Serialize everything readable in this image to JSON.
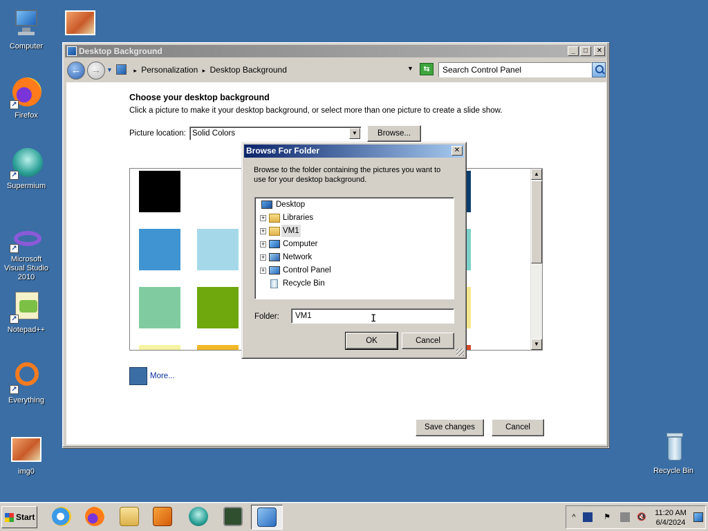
{
  "desktop": {
    "icons": [
      {
        "label": "Computer"
      },
      {
        "label": "Firefox"
      },
      {
        "label": "Supermium"
      },
      {
        "label": "Microsoft Visual Studio 2010"
      },
      {
        "label": "Notepad++"
      },
      {
        "label": "Everything"
      },
      {
        "label": "img0"
      },
      {
        "label": "Recycle Bin"
      }
    ]
  },
  "window": {
    "title": "Desktop Background",
    "breadcrumb": [
      "Personalization",
      "Desktop Background"
    ],
    "search_placeholder": "Search Control Panel",
    "heading": "Choose your desktop background",
    "subtext": "Click a picture to make it your desktop background, or select more than one picture to create a slide show.",
    "picture_location_label": "Picture location:",
    "picture_location_value": "Solid Colors",
    "browse_label": "Browse...",
    "swatches": [
      "#000000",
      "#0a3d6b",
      "#3f94d1",
      "#a5d9ea",
      "#7bd0c9",
      "#80cca0",
      "#6ea80d",
      "#f4e78b",
      "#f6f3a2",
      "#f3b827",
      "#d4492a"
    ],
    "more_label": "More...",
    "more_color": "#3b6ea5",
    "save_label": "Save changes",
    "cancel_label": "Cancel"
  },
  "dialog": {
    "title": "Browse For Folder",
    "close_label": "✕",
    "description": "Browse to the folder containing the pictures you want to use for your desktop background.",
    "tree": [
      {
        "label": "Desktop",
        "icon": "desktop-icon"
      },
      {
        "label": "Libraries",
        "icon": "libraries-icon"
      },
      {
        "label": "VM1",
        "icon": "user-folder-icon",
        "selected": true
      },
      {
        "label": "Computer",
        "icon": "computer-icon"
      },
      {
        "label": "Network",
        "icon": "network-icon"
      },
      {
        "label": "Control Panel",
        "icon": "control-panel-icon"
      },
      {
        "label": "Recycle Bin",
        "icon": "recycle-bin-icon"
      }
    ],
    "folder_label": "Folder:",
    "folder_value": "VM1",
    "ok_label": "OK",
    "cancel_label": "Cancel"
  },
  "taskbar": {
    "start_label": "Start",
    "apps": [
      "internet-explorer-icon",
      "firefox-icon",
      "file-explorer-icon",
      "media-player-icon",
      "supermium-icon",
      "task-manager-icon",
      "control-panel-icon"
    ],
    "clock_time": "11:20 AM",
    "clock_date": "6/4/2024",
    "tray_expand": "^"
  }
}
